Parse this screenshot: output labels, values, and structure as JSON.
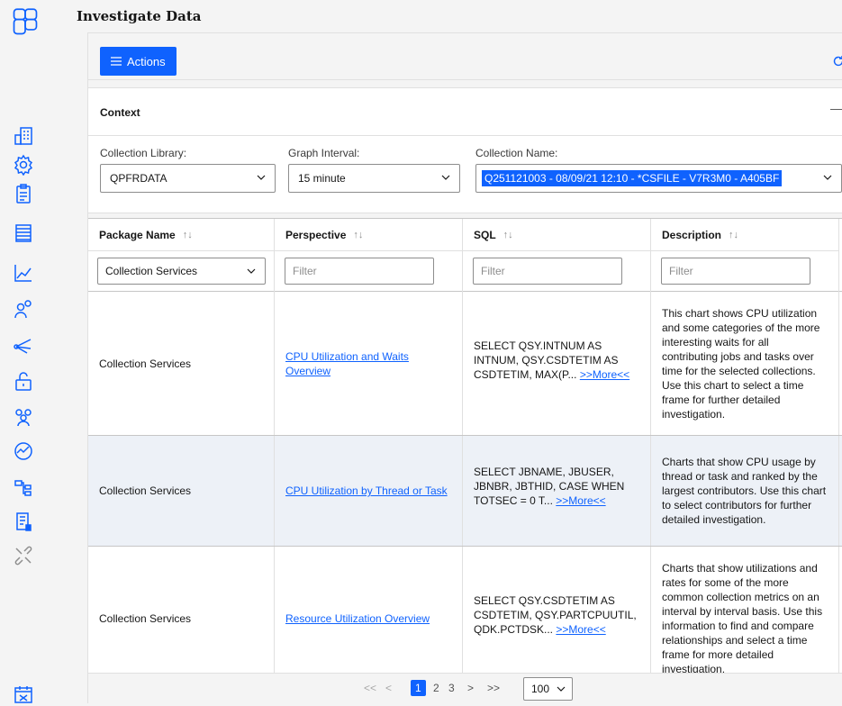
{
  "page": {
    "title": "Investigate Data"
  },
  "sidebar": {
    "icons": [
      "app-logo-icon",
      "building-icon",
      "settings-icon",
      "clipboard-icon",
      "database-table-icon",
      "line-chart-icon",
      "user-settings-icon",
      "network-icon",
      "unlock-icon",
      "group-icon",
      "performance-gauge-icon",
      "hierarchy-icon",
      "report-icon",
      "tools-icon",
      "calendar-icon"
    ]
  },
  "toolbar": {
    "actions_label": "Actions"
  },
  "context": {
    "heading": "Context",
    "collection_library": {
      "label": "Collection Library:",
      "value": "QPFRDATA"
    },
    "graph_interval": {
      "label": "Graph Interval:",
      "value": "15 minute"
    },
    "collection_name": {
      "label": "Collection Name:",
      "value": "Q251121003 - 08/09/21 12:10 - *CSFILE - V7R3M0 - A405BF"
    }
  },
  "table": {
    "columns": [
      {
        "label": "Package Name",
        "sort": "↑↓"
      },
      {
        "label": "Perspective",
        "sort": "↑↓"
      },
      {
        "label": "SQL",
        "sort": "↑↓"
      },
      {
        "label": "Description",
        "sort": "↑↓"
      }
    ],
    "filters": {
      "package_value": "Collection Services",
      "perspective_placeholder": "Filter",
      "sql_placeholder": "Filter",
      "description_placeholder": "Filter"
    },
    "more_label": ">>More<<",
    "rows": [
      {
        "package": "Collection Services",
        "perspective": "CPU Utilization and Waits Overview",
        "sql": "SELECT QSY.INTNUM AS INTNUM, QSY.CSDTETIM AS CSDTETIM, MAX(P...",
        "description": "This chart shows CPU utilization and some categories of the more interesting waits for all contributing jobs and tasks over time for the selected collections. Use this chart to select a time frame for further detailed investigation."
      },
      {
        "package": "Collection Services",
        "perspective": "CPU Utilization by Thread or Task",
        "sql": "SELECT JBNAME, JBUSER, JBNBR, JBTHID, CASE WHEN TOTSEC = 0 T...",
        "description": "Charts that show CPU usage by thread or task and ranked by the largest contributors. Use this chart to select contributors for further detailed investigation."
      },
      {
        "package": "Collection Services",
        "perspective": "Resource Utilization Overview",
        "sql": "SELECT QSY.CSDTETIM AS CSDTETIM, QSY.PARTCPUUTIL, QDK.PCTDSK...",
        "description": "Charts that show utilizations and rates for some of the more common collection metrics on an interval by interval basis. Use this information to find and compare relationships and select a time frame for more detailed investigation."
      }
    ]
  },
  "pagination": {
    "first": "<<",
    "prev": "<",
    "pages": [
      "1",
      "2",
      "3"
    ],
    "next": ">",
    "last": ">>",
    "page_size": "100"
  }
}
